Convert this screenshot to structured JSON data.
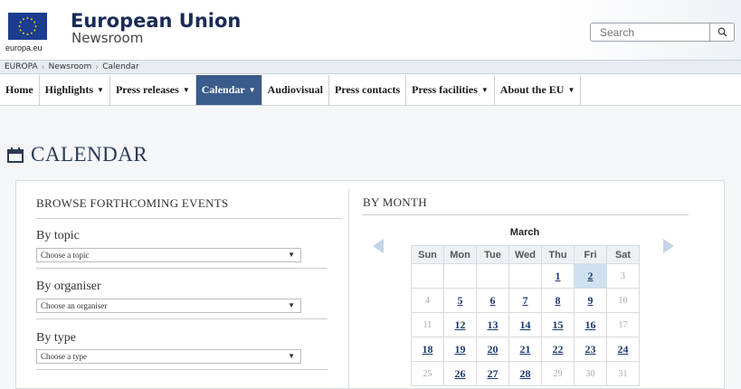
{
  "header": {
    "logo_caption": "europa.eu",
    "title": "European Union",
    "subtitle": "Newsroom",
    "search_placeholder": "Search",
    "brand_color": "#1a3d8f"
  },
  "breadcrumb": [
    "EUROPA",
    "Newsroom",
    "Calendar"
  ],
  "nav": [
    {
      "label": "Home",
      "dropdown": false,
      "active": false
    },
    {
      "label": "Highlights",
      "dropdown": true,
      "active": false
    },
    {
      "label": "Press releases",
      "dropdown": true,
      "active": false
    },
    {
      "label": "Calendar",
      "dropdown": true,
      "active": true
    },
    {
      "label": "Audiovisual",
      "dropdown": false,
      "active": false
    },
    {
      "label": "Press contacts",
      "dropdown": false,
      "active": false
    },
    {
      "label": "Press facilities",
      "dropdown": true,
      "active": false
    },
    {
      "label": "About the EU",
      "dropdown": true,
      "active": false
    }
  ],
  "page_title": "CALENDAR",
  "browse": {
    "title": "BROWSE FORTHCOMING EVENTS",
    "filters": [
      {
        "label": "By topic",
        "value": "Choose a topic"
      },
      {
        "label": "By organiser",
        "value": "Choose an organiser"
      },
      {
        "label": "By type",
        "value": "Choose a type"
      }
    ]
  },
  "by_month": {
    "title": "BY MONTH",
    "month": "March",
    "weekdays": [
      "Sun",
      "Mon",
      "Tue",
      "Wed",
      "Thu",
      "Fri",
      "Sat"
    ],
    "weeks": [
      [
        {
          "d": ""
        },
        {
          "d": ""
        },
        {
          "d": ""
        },
        {
          "d": ""
        },
        {
          "d": "1",
          "e": true
        },
        {
          "d": "2",
          "e": true,
          "today": true
        },
        {
          "d": "3"
        }
      ],
      [
        {
          "d": "4"
        },
        {
          "d": "5",
          "e": true
        },
        {
          "d": "6",
          "e": true
        },
        {
          "d": "7",
          "e": true
        },
        {
          "d": "8",
          "e": true
        },
        {
          "d": "9",
          "e": true
        },
        {
          "d": "10"
        }
      ],
      [
        {
          "d": "11"
        },
        {
          "d": "12",
          "e": true
        },
        {
          "d": "13",
          "e": true
        },
        {
          "d": "14",
          "e": true
        },
        {
          "d": "15",
          "e": true
        },
        {
          "d": "16",
          "e": true
        },
        {
          "d": "17"
        }
      ],
      [
        {
          "d": "18",
          "e": true
        },
        {
          "d": "19",
          "e": true
        },
        {
          "d": "20",
          "e": true
        },
        {
          "d": "21",
          "e": true
        },
        {
          "d": "22",
          "e": true
        },
        {
          "d": "23",
          "e": true
        },
        {
          "d": "24",
          "e": true
        }
      ],
      [
        {
          "d": "25"
        },
        {
          "d": "26",
          "e": true
        },
        {
          "d": "27",
          "e": true
        },
        {
          "d": "28",
          "e": true
        },
        {
          "d": "29"
        },
        {
          "d": "30"
        },
        {
          "d": "31"
        }
      ]
    ]
  }
}
